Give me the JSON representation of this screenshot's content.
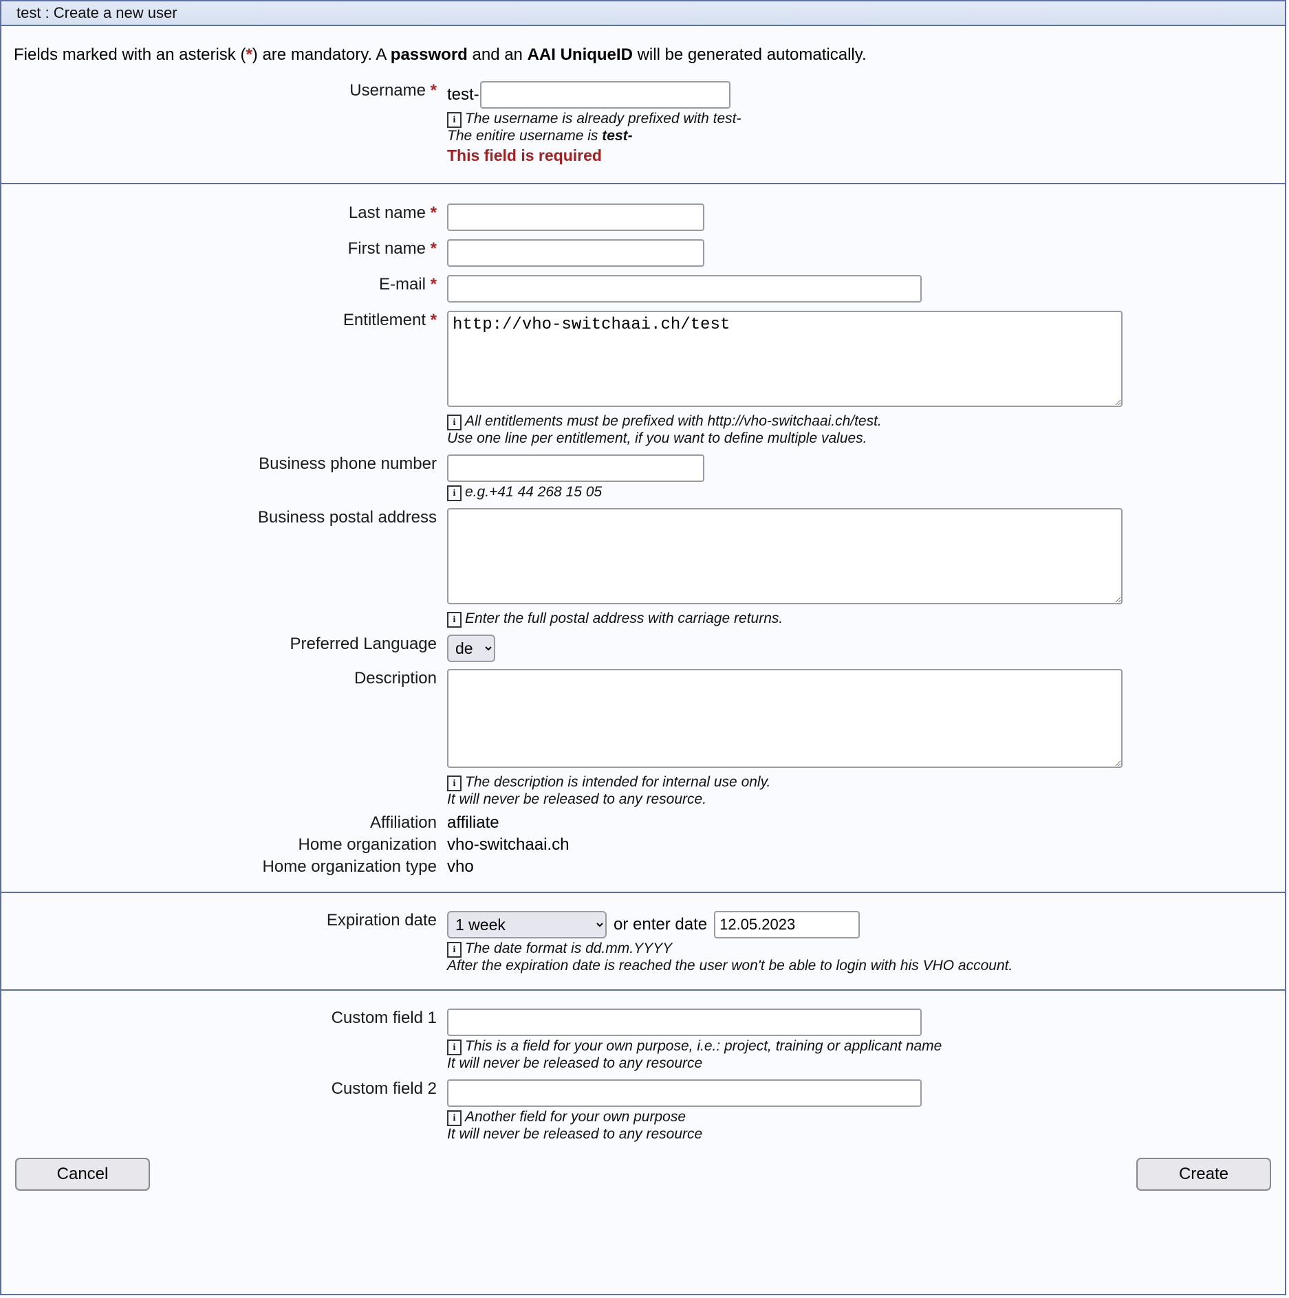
{
  "window": {
    "title": "test : Create a new user"
  },
  "intro": {
    "part1": "Fields marked with an asterisk (",
    "asterisk": "*",
    "part2": ") are mandatory. A ",
    "bold1": "password",
    "part3": " and an ",
    "bold2": "AAI UniqueID",
    "part4": " will be generated automatically."
  },
  "username": {
    "label": "Username",
    "required_mark": "*",
    "prefix": "test-",
    "value": "",
    "hint_line1": "The username is already prefixed with test-",
    "hint_line2_pre": "The enitire username is ",
    "hint_line2_bold": "test-",
    "error": "This field is required"
  },
  "fields": {
    "last_name": {
      "label": "Last name",
      "required_mark": "*",
      "value": ""
    },
    "first_name": {
      "label": "First name",
      "required_mark": "*",
      "value": ""
    },
    "email": {
      "label": "E-mail",
      "required_mark": "*",
      "value": ""
    },
    "entitlement": {
      "label": "Entitlement",
      "required_mark": "*",
      "value": "http://vho-switchaai.ch/test",
      "hint_line1": "All entitlements must be prefixed with http://vho-switchaai.ch/test.",
      "hint_line2": "Use one line per entitlement, if you want to define multiple values."
    },
    "business_phone": {
      "label": "Business phone number",
      "value": "",
      "hint_line1": "e.g.+41 44 268 15 05"
    },
    "business_postal": {
      "label": "Business postal address",
      "value": "",
      "hint_line1": "Enter the full postal address with carriage returns."
    },
    "preferred_language": {
      "label": "Preferred Language",
      "selected": "de",
      "options": [
        "de"
      ]
    },
    "description": {
      "label": "Description",
      "value": "",
      "hint_line1": "The description is intended for internal use only.",
      "hint_line2": "It will never be released to any resource."
    },
    "affiliation": {
      "label": "Affiliation",
      "value": "affiliate"
    },
    "home_organization": {
      "label": "Home organization",
      "value": "vho-switchaai.ch"
    },
    "home_organization_type": {
      "label": "Home organization type",
      "value": "vho"
    }
  },
  "expiration": {
    "label": "Expiration date",
    "selected": "1 week",
    "options": [
      "1 week"
    ],
    "mid_text": "or enter date",
    "date_value": "12.05.2023",
    "hint_line1": "The date format is dd.mm.YYYY",
    "hint_line2": "After the expiration date is reached the user won't be able to login with his VHO account."
  },
  "custom": {
    "field1": {
      "label": "Custom field 1",
      "value": "",
      "hint_line1": "This is a field for your own purpose, i.e.: project, training or applicant name",
      "hint_line2": "It will never be released to any resource"
    },
    "field2": {
      "label": "Custom field 2",
      "value": "",
      "hint_line1": "Another field for your own purpose",
      "hint_line2": "It will never be released to any resource"
    }
  },
  "buttons": {
    "cancel": "Cancel",
    "create": "Create"
  },
  "icons": {
    "info": "i"
  },
  "colors": {
    "border": "#5b6fa6",
    "error": "#a32020",
    "required": "#b22222",
    "titlebar": "#d6e0f0"
  }
}
